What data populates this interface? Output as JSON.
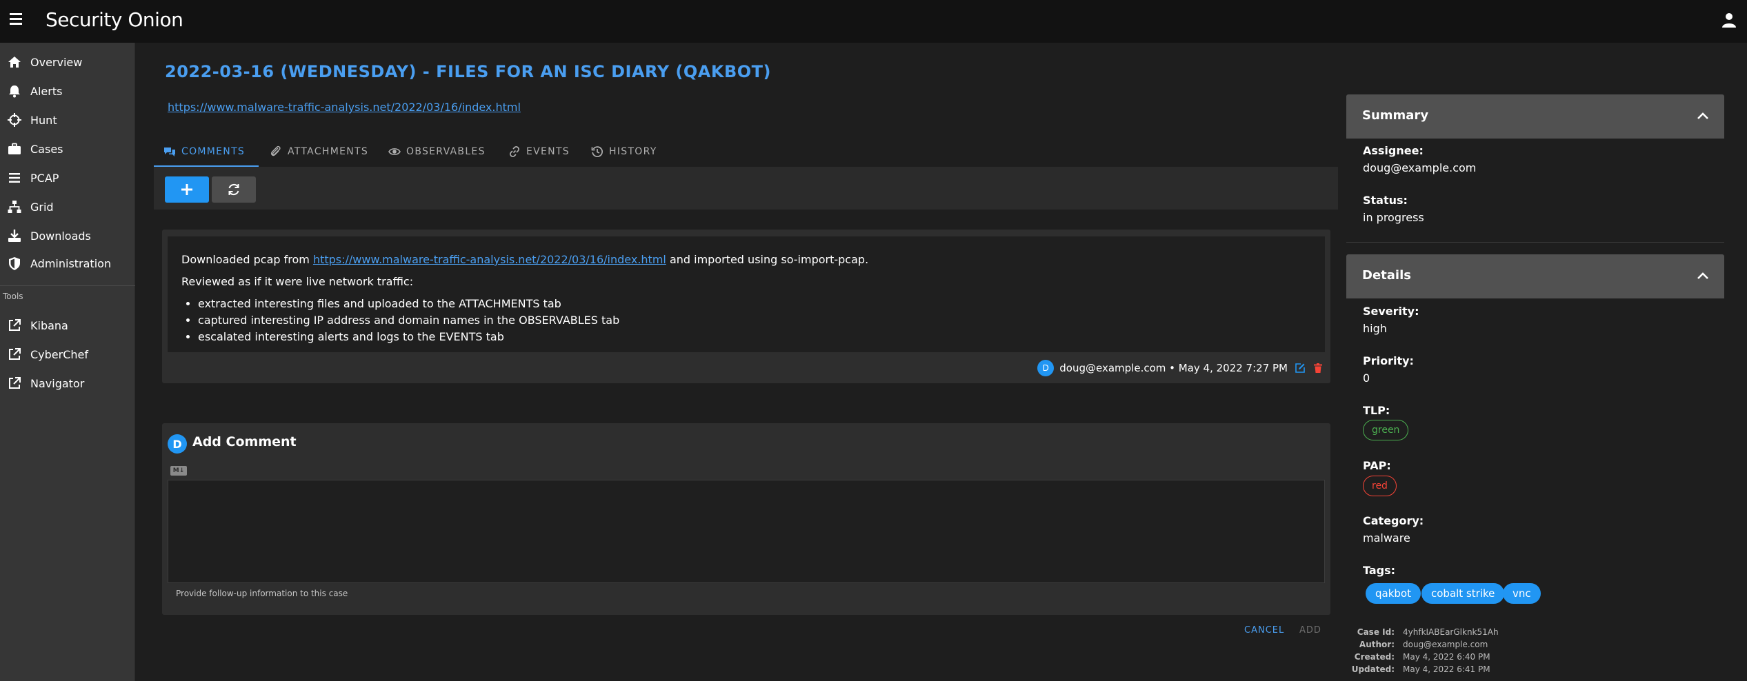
{
  "app": {
    "logo_text": "Security Onion"
  },
  "sidebar": {
    "items": [
      {
        "label": "Overview"
      },
      {
        "label": "Alerts"
      },
      {
        "label": "Hunt"
      },
      {
        "label": "Cases"
      },
      {
        "label": "PCAP"
      },
      {
        "label": "Grid"
      },
      {
        "label": "Downloads"
      },
      {
        "label": "Administration"
      }
    ],
    "tools_label": "Tools",
    "tools": [
      {
        "label": "Kibana"
      },
      {
        "label": "CyberChef"
      },
      {
        "label": "Navigator"
      }
    ]
  },
  "case": {
    "title": "2022-03-16 (WEDNESDAY) - FILES FOR AN ISC DIARY (QAKBOT)",
    "link": "https://www.malware-traffic-analysis.net/2022/03/16/index.html"
  },
  "tabs": [
    {
      "label": "COMMENTS"
    },
    {
      "label": "ATTACHMENTS"
    },
    {
      "label": "OBSERVABLES"
    },
    {
      "label": "EVENTS"
    },
    {
      "label": "HISTORY"
    }
  ],
  "comment": {
    "line1_prefix": "Downloaded pcap from ",
    "line1_link": "https://www.malware-traffic-analysis.net/2022/03/16/index.html",
    "line1_suffix": " and imported using so-import-pcap.",
    "line2": "Reviewed as if it were live network traffic:",
    "bullets": [
      "extracted interesting files and uploaded to the ATTACHMENTS tab",
      "captured interesting IP address and domain names in the OBSERVABLES tab",
      "escalated interesting alerts and logs to the EVENTS tab"
    ],
    "avatar_initial": "D",
    "meta": "doug@example.com • May 4, 2022 7:27 PM"
  },
  "add_comment": {
    "avatar_initial": "D",
    "title": "Add Comment",
    "md_badge": "M↓",
    "textarea_value": "",
    "hint": "Provide follow-up information to this case",
    "cancel_label": "CANCEL",
    "add_label": "ADD"
  },
  "summary": {
    "header": "Summary",
    "assignee_label": "Assignee:",
    "assignee": "doug@example.com",
    "status_label": "Status:",
    "status": "in progress"
  },
  "details": {
    "header": "Details",
    "severity_label": "Severity:",
    "severity": "high",
    "priority_label": "Priority:",
    "priority": "0",
    "tlp_label": "TLP:",
    "tlp": "green",
    "pap_label": "PAP:",
    "pap": "red",
    "category_label": "Category:",
    "category": "malware",
    "tags_label": "Tags:",
    "tags": [
      "qakbot",
      "cobalt strike",
      "vnc"
    ]
  },
  "case_meta": {
    "id_label": "Case Id:",
    "id": "4yhfkIABEarGlknk51Ah",
    "author_label": "Author:",
    "author": "doug@example.com",
    "created_label": "Created:",
    "created": "May 4, 2022 6:40 PM",
    "updated_label": "Updated:",
    "updated": "May 4, 2022 6:41 PM"
  },
  "colors": {
    "accent": "#2196f3",
    "link": "#4a9ef0",
    "tlp_green": "#4caf50",
    "pap_red": "#f44336",
    "delete_red": "#f44336"
  },
  "icons": {
    "menu": "hamburger-icon",
    "user": "user-icon",
    "refresh": "refresh-icon",
    "edit": "edit-icon",
    "delete": "trash-icon"
  }
}
